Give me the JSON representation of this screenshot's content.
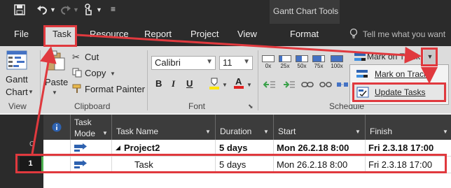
{
  "context_tools_label": "Gantt Chart Tools",
  "tabs": [
    "File",
    "Task",
    "Resource",
    "Report",
    "Project",
    "View",
    "Format"
  ],
  "tell_me_placeholder": "Tell me what you want",
  "ribbon": {
    "view_group": {
      "button_label_1": "Gantt",
      "button_label_2": "Chart",
      "group_label": "View"
    },
    "clipboard_group": {
      "paste_label": "Paste",
      "cut_label": "Cut",
      "copy_label": "Copy",
      "format_painter_label": "Format Painter",
      "group_label": "Clipboard"
    },
    "font_group": {
      "font_name": "Calibri",
      "font_size": "11",
      "group_label": "Font"
    },
    "schedule_group": {
      "percent_buttons": [
        "0x",
        "25x",
        "50x",
        "75x",
        "100x"
      ],
      "group_label": "Schedule"
    },
    "mark_on_track_label": "Mark on Track"
  },
  "dropdown_menu": {
    "items": [
      "Mark on Track",
      "Update Tasks"
    ]
  },
  "grid": {
    "headers": {
      "task_mode_1": "Task",
      "task_mode_2": "Mode",
      "task_name": "Task Name",
      "duration": "Duration",
      "start": "Start",
      "finish": "Finish"
    },
    "rows": [
      {
        "id": "",
        "name": "Project2",
        "duration": "5 days",
        "start": "Mon 26.2.18 8:00",
        "finish": "Fri 2.3.18 17:00",
        "summary": true
      },
      {
        "id": "1",
        "name": "Task",
        "duration": "5 days",
        "start": "Mon 26.2.18 8:00",
        "finish": "Fri 2.3.18 17:00",
        "summary": false
      }
    ],
    "side_marker": "C"
  },
  "colors": {
    "annotation": "#e0393e",
    "ribbon": "#dcdcdc",
    "titlebar": "#2b2b2b"
  }
}
